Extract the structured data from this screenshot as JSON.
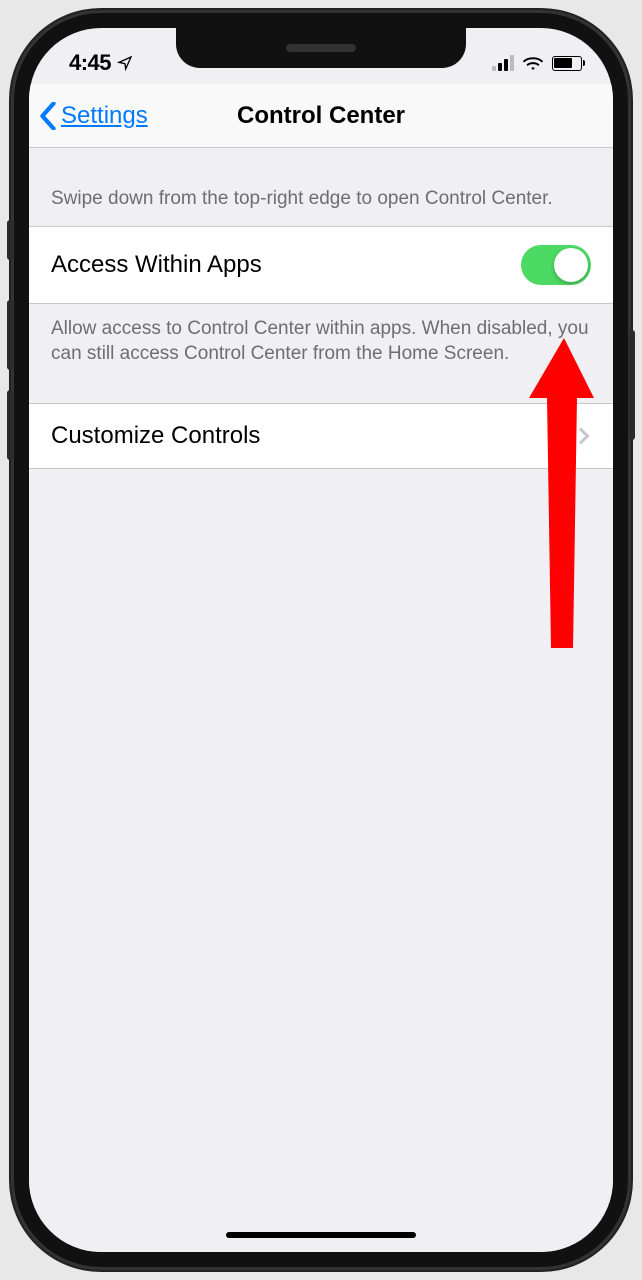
{
  "status": {
    "time": "4:45",
    "location_icon": "location"
  },
  "nav": {
    "back_label": "Settings",
    "title": "Control Center"
  },
  "sections": {
    "intro": "Swipe down from the top-right edge to open Control Center.",
    "access": {
      "label": "Access Within Apps",
      "enabled": true,
      "footer": "Allow access to Control Center within apps. When disabled, you can still access Control Center from the Home Screen."
    },
    "customize": {
      "label": "Customize Controls"
    }
  },
  "colors": {
    "accent": "#007aff",
    "toggle_on": "#4cd964",
    "arrow": "#ff0000"
  }
}
